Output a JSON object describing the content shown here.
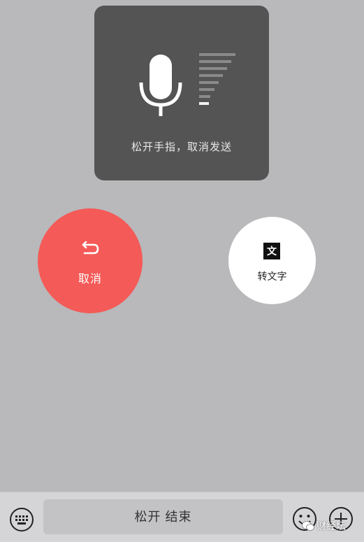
{
  "overlay": {
    "hint": "松开手指，取消发送",
    "voice_level": 0.14
  },
  "cancel": {
    "label": "取消"
  },
  "convert": {
    "badge": "文",
    "label": "转文字"
  },
  "input_bar": {
    "hold_label": "松开 结束"
  },
  "watermark": {
    "text": "财经坛"
  },
  "colors": {
    "background": "#b9b8bb",
    "overlay": "#545454",
    "cancel": "#f45a57",
    "convert": "#ffffff"
  }
}
